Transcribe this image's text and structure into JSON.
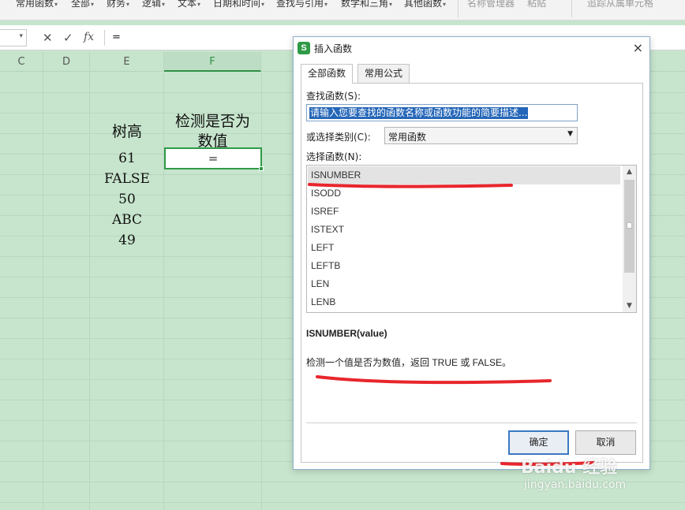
{
  "ribbon": {
    "items": [
      "常用函数",
      "全部",
      "财务",
      "逻辑",
      "文本",
      "日期和时间",
      "查找与引用",
      "数学和三角",
      "其他函数",
      "名称管理器",
      "粘贴",
      "追踪从属单元格"
    ]
  },
  "formula_bar": {
    "cancel_icon": "✕",
    "confirm_icon": "✓",
    "fx_label": "fx",
    "content": "="
  },
  "columns": [
    "C",
    "D",
    "E",
    "F"
  ],
  "cells": {
    "e_header": "树高",
    "f_header_line1": "检测是否为",
    "f_header_line2": "数值",
    "e_values": [
      "61",
      "FALSE",
      "50",
      "ABC",
      "49"
    ],
    "f_active_value": "="
  },
  "dialog": {
    "title": "插入函数",
    "app_icon_letter": "S",
    "close_icon": "×",
    "tabs": [
      "全部函数",
      "常用公式"
    ],
    "search_label": "查找函数(S):",
    "search_text": "请输入您要查找的函数名称或函数功能的简要描述...",
    "category_label": "或选择类别(C):",
    "category_value": "常用函数",
    "list_label": "选择函数(N):",
    "functions": [
      "ISNUMBER",
      "ISODD",
      "ISREF",
      "ISTEXT",
      "LEFT",
      "LEFTB",
      "LEN",
      "LENB"
    ],
    "selected_function": "ISNUMBER",
    "signature": "ISNUMBER(value)",
    "description": "检测一个值是否为数值，返回 TRUE 或 FALSE。",
    "ok_label": "确定",
    "cancel_label": "取消"
  },
  "annotation_color": "#e8262d",
  "accent_color": "#2f9a47",
  "watermark": {
    "brand": "Baidu 经验",
    "url": "jingyan.baidu.com"
  }
}
